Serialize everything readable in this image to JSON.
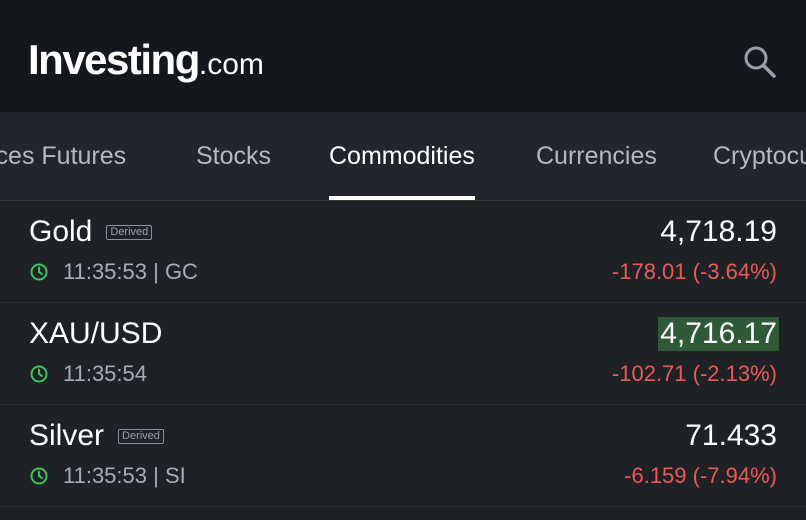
{
  "header": {
    "logo_main": "Investing",
    "logo_suffix": ".com",
    "accent_color": "#f7a21b"
  },
  "tabs": [
    {
      "label": "ices Futures",
      "active": false
    },
    {
      "label": "Stocks",
      "active": false
    },
    {
      "label": "Commodities",
      "active": true
    },
    {
      "label": "Currencies",
      "active": false
    },
    {
      "label": "Cryptocu",
      "active": false
    }
  ],
  "instruments": [
    {
      "name": "Gold",
      "badge": "Derived",
      "time": "11:35:53 | GC",
      "price": "4,718.19",
      "change": "-178.01 (-3.64%)"
    },
    {
      "name": "XAU/USD",
      "badge": "",
      "time": "11:35:54",
      "price": "4,716.17",
      "change": "-102.71 (-2.13%)"
    },
    {
      "name": "Silver",
      "badge": "Derived",
      "time": "11:35:53 | SI",
      "price": "71.433",
      "change": "-6.159 (-7.94%)"
    }
  ],
  "colors": {
    "negative": "#ec5a52",
    "clock_green": "#3cc35c",
    "flash_bg": "#2f5a37"
  }
}
